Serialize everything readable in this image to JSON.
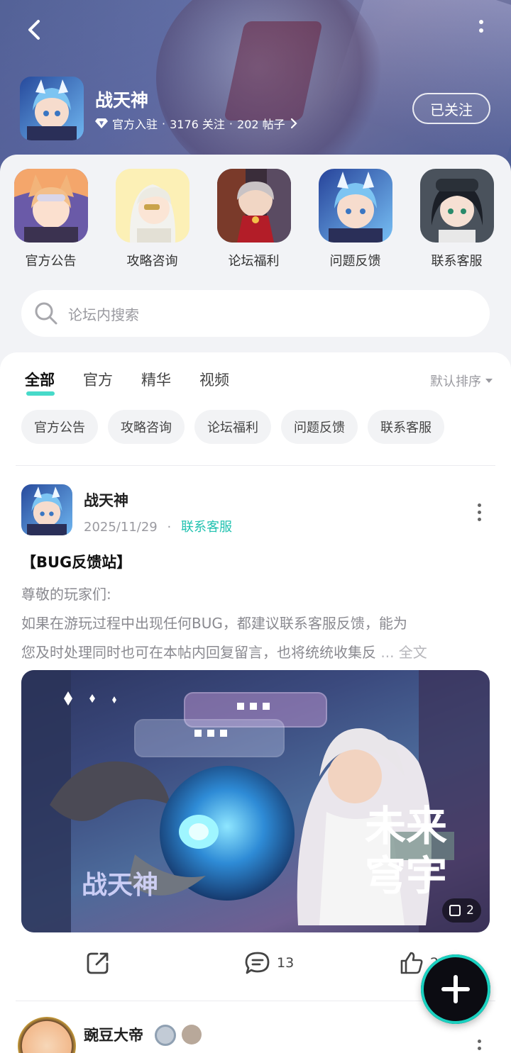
{
  "header": {
    "forum_name": "战天神",
    "meta_official": "官方入驻",
    "meta_followers": "3176 关注",
    "meta_posts": "202 帖子",
    "follow_label": "已关注"
  },
  "shortcuts": [
    {
      "label": "官方公告",
      "color": "#f08a5d"
    },
    {
      "label": "攻略咨询",
      "color": "#f1d46b"
    },
    {
      "label": "论坛福利",
      "color": "#b9543d"
    },
    {
      "label": "问题反馈",
      "color": "#5b95e0"
    },
    {
      "label": "联系客服",
      "color": "#3d4650"
    }
  ],
  "search": {
    "placeholder": "论坛内搜索"
  },
  "tabs": [
    "全部",
    "官方",
    "精华",
    "视频"
  ],
  "sort_label": "默认排序",
  "chips": [
    "官方公告",
    "攻略咨询",
    "论坛福利",
    "问题反馈",
    "联系客服"
  ],
  "post": {
    "author": "战天神",
    "date": "2025/11/29",
    "separator": "·",
    "category": "联系客服",
    "title": "【BUG反馈站】",
    "body_line1": "尊敬的玩家们:",
    "body_line2": " 如果在游玩过程中出现任何BUG，都建议联系客服反馈，能为",
    "body_line3": "您及时处理同时也可在本帖内回复留言，也将统统收集反",
    "more": "... 全文",
    "image_text_1": "未来",
    "image_text_2": "穹宇",
    "image_text_3": "战天神",
    "image_count": "2",
    "comments": "13",
    "likes": "2"
  },
  "post2": {
    "author": "豌豆大帝"
  },
  "accent_color": "#21c2b0"
}
